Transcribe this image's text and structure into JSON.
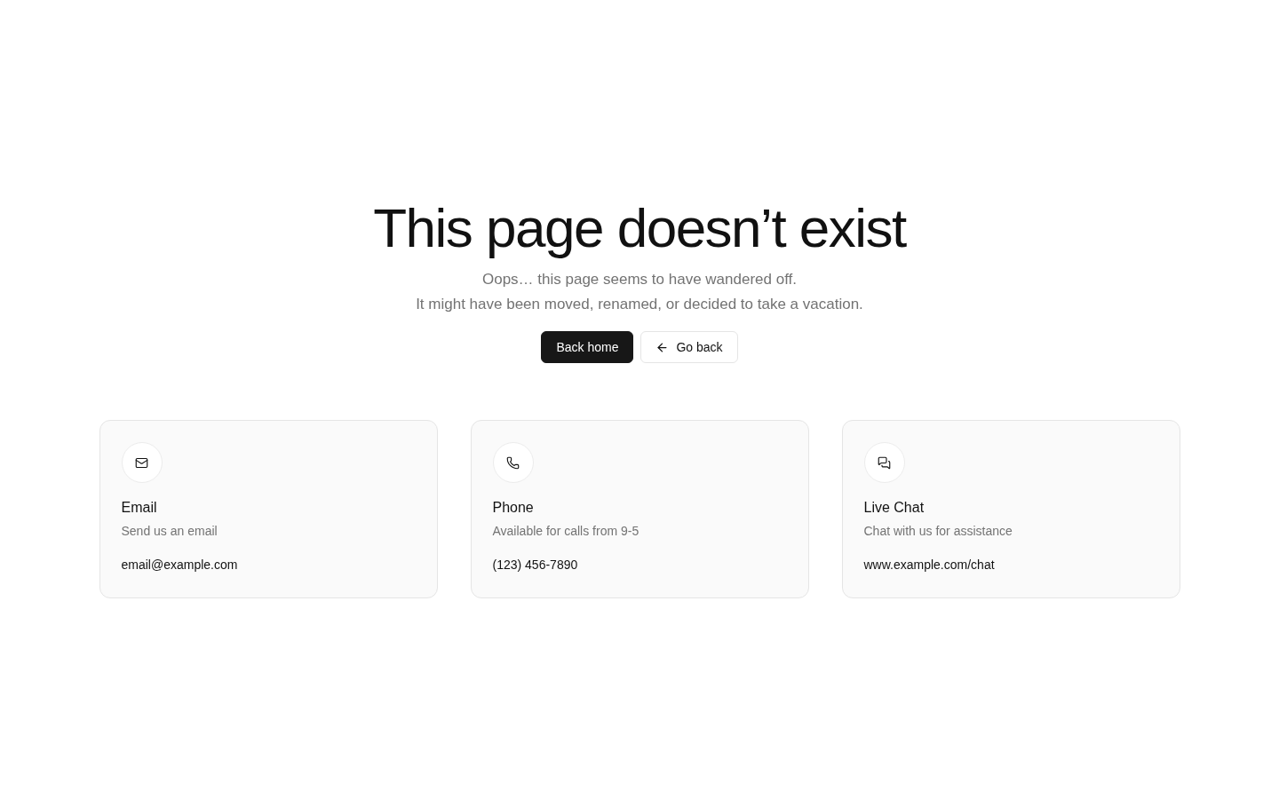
{
  "heading": "This page doesn’t exist",
  "lines": [
    "Oops… this page seems to have wandered off.",
    "It might have been moved, renamed, or decided to take a vacation."
  ],
  "buttons": [
    {
      "label": "Back home",
      "kind": "primary"
    },
    {
      "label": "Go back",
      "kind": "back"
    }
  ],
  "cards": [
    {
      "kind": "email",
      "title": "Email",
      "description": "Send us an email",
      "contact": "email@example.com"
    },
    {
      "kind": "phone",
      "title": "Phone",
      "description": "Available for calls from 9-5",
      "contact": "(123) 456-7890"
    },
    {
      "kind": "chat",
      "title": "Live Chat",
      "description": "Chat with us for assistance",
      "contact": "www.example.com/chat"
    }
  ]
}
